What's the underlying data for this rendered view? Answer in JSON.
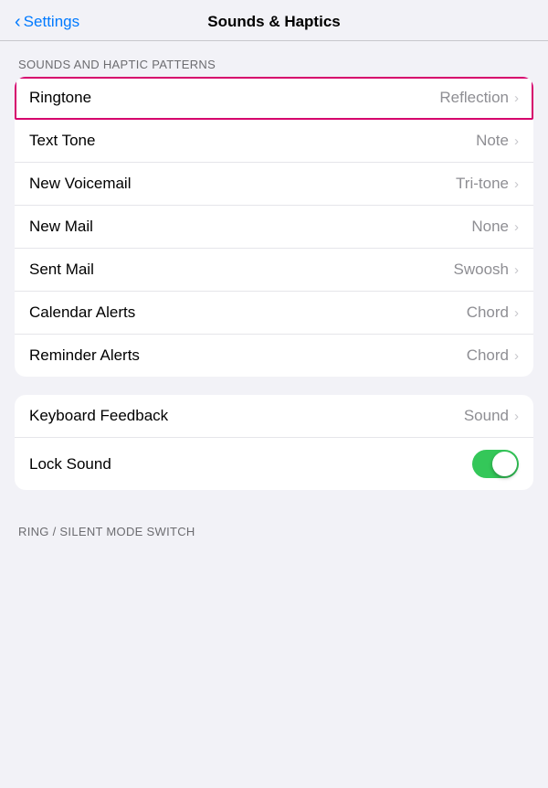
{
  "header": {
    "back_label": "Settings",
    "title": "Sounds & Haptics"
  },
  "sections": {
    "sounds_patterns": {
      "label": "SOUNDS AND HAPTIC PATTERNS",
      "rows": [
        {
          "id": "ringtone",
          "label": "Ringtone",
          "value": "Reflection",
          "highlighted": true
        },
        {
          "id": "text-tone",
          "label": "Text Tone",
          "value": "Note",
          "highlighted": false
        },
        {
          "id": "new-voicemail",
          "label": "New Voicemail",
          "value": "Tri-tone",
          "highlighted": false
        },
        {
          "id": "new-mail",
          "label": "New Mail",
          "value": "None",
          "highlighted": false
        },
        {
          "id": "sent-mail",
          "label": "Sent Mail",
          "value": "Swoosh",
          "highlighted": false
        },
        {
          "id": "calendar-alerts",
          "label": "Calendar Alerts",
          "value": "Chord",
          "highlighted": false
        },
        {
          "id": "reminder-alerts",
          "label": "Reminder Alerts",
          "value": "Chord",
          "highlighted": false
        }
      ]
    },
    "feedback": {
      "rows": [
        {
          "id": "keyboard-feedback",
          "label": "Keyboard Feedback",
          "value": "Sound",
          "type": "nav"
        },
        {
          "id": "lock-sound",
          "label": "Lock Sound",
          "value": "",
          "type": "toggle",
          "toggle_on": true
        }
      ]
    },
    "ring_silent": {
      "label": "RING / SILENT MODE SWITCH"
    }
  },
  "icons": {
    "chevron": "›",
    "back_chevron": "‹"
  }
}
